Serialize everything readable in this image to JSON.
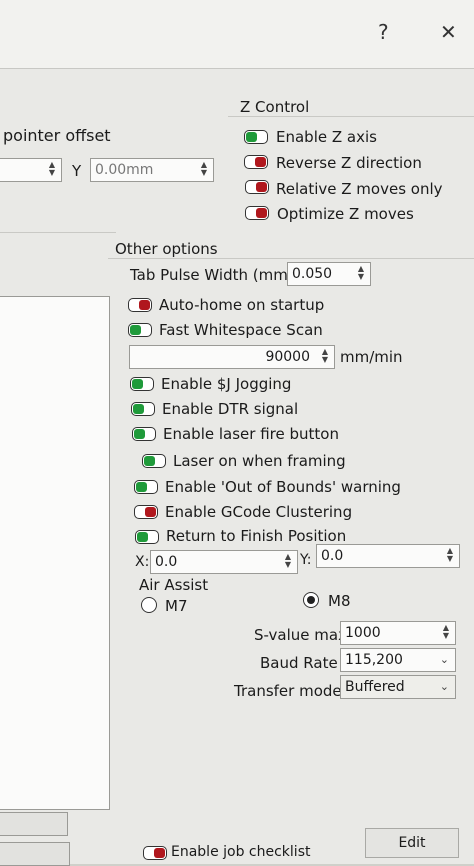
{
  "window": {
    "help_glyph": "?",
    "close_glyph": "✕"
  },
  "left_partial": {
    "pointer_offset_label": "pointer offset",
    "y_label": "Y",
    "y_value": "0.00mm"
  },
  "z_control": {
    "title": "Z Control",
    "options": [
      {
        "label": "Enable Z axis",
        "on": true
      },
      {
        "label": "Reverse Z direction",
        "on": false
      },
      {
        "label": "Relative Z moves only",
        "on": false
      },
      {
        "label": "Optimize Z moves",
        "on": false
      }
    ]
  },
  "other_options": {
    "title": "Other options",
    "tab_pulse_label": "Tab Pulse Width (mm)",
    "tab_pulse_value": "0.050",
    "auto_home_label": "Auto-home on startup",
    "fast_whitespace_label": "Fast Whitespace Scan",
    "scan_speed_value": "90000",
    "scan_speed_unit": "mm/min",
    "toggles": [
      {
        "label": "Enable $J Jogging",
        "on": true
      },
      {
        "label": "Enable DTR signal",
        "on": true
      },
      {
        "label": "Enable laser fire button",
        "on": true
      },
      {
        "label": "Laser on when framing",
        "on": true
      },
      {
        "label": "Enable 'Out of Bounds' warning",
        "on": true
      },
      {
        "label": "Enable GCode Clustering",
        "on": false
      },
      {
        "label": "Return to Finish Position",
        "on": true
      }
    ],
    "finish_x_label": "X:",
    "finish_x_value": "0.0",
    "finish_y_label": "Y:",
    "finish_y_value": "0.0",
    "air_assist_label": "Air Assist",
    "m7_label": "M7",
    "m8_label": "M8",
    "air_assist_selected": "M8",
    "s_value_label": "S-value max",
    "s_value": "1000",
    "baud_label": "Baud Rate",
    "baud_value": "115,200",
    "transfer_label": "Transfer mode",
    "transfer_value": "Buffered"
  },
  "footer": {
    "job_checklist_label": "Enable job checklist",
    "job_checklist_on": false,
    "edit_label": "Edit"
  }
}
